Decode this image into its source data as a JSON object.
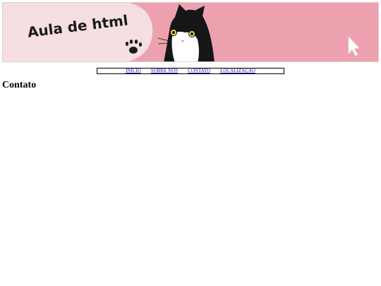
{
  "banner": {
    "title": "Aula de html",
    "background_color": "#eda1ae",
    "bubble_color": "#f5dfe2",
    "icons": [
      "paw-icon",
      "cat-illustration",
      "cursor-arrow-icon"
    ]
  },
  "nav": {
    "items": [
      {
        "label": "INÍCIO"
      },
      {
        "label": "SOBRE NÓS"
      },
      {
        "label": "CONTATO"
      },
      {
        "label": "LOCALIZAÇÃO"
      }
    ],
    "link_color": "#1a0dab"
  },
  "main": {
    "heading": "Contato"
  }
}
